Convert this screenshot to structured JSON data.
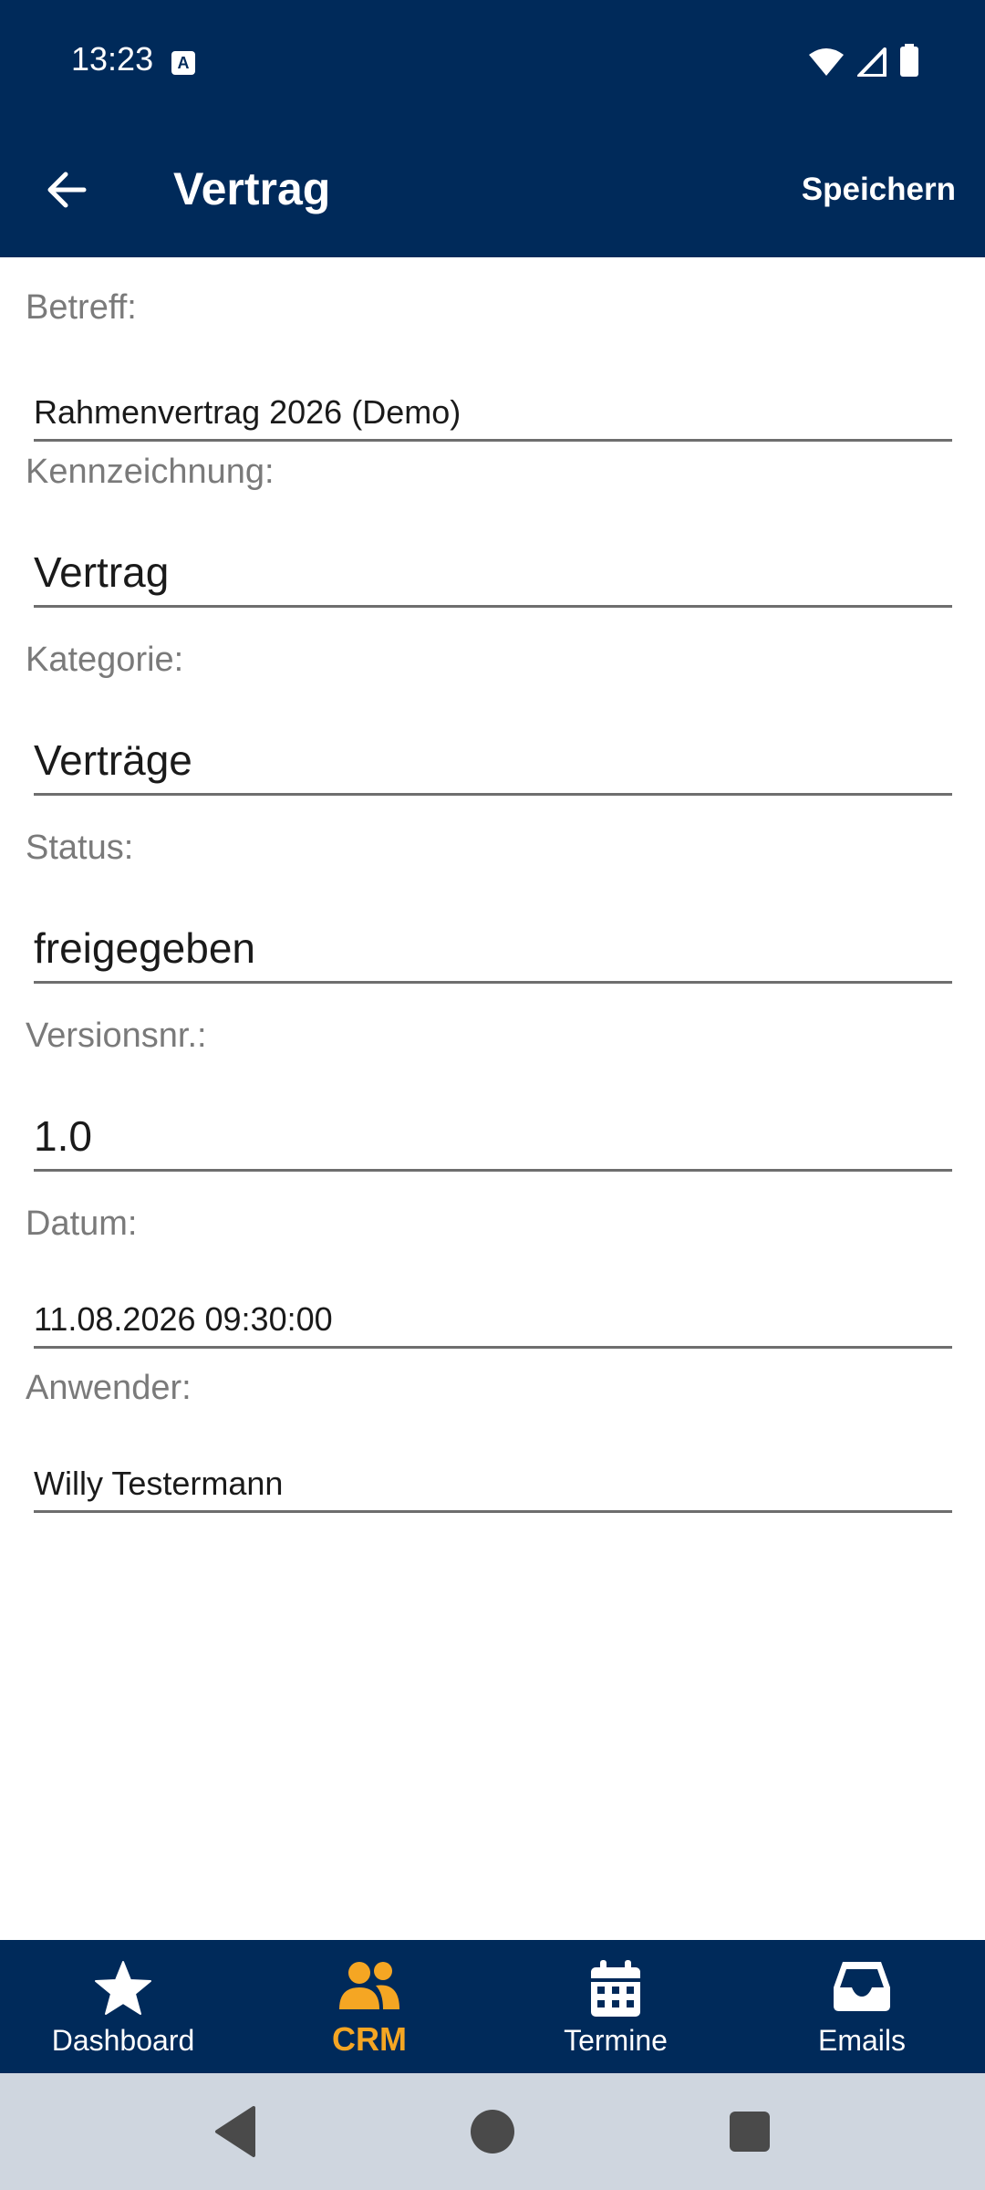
{
  "status_bar": {
    "time": "13:23",
    "notification_icon": "A",
    "icons": [
      "wifi-icon",
      "signal-icon",
      "battery-icon"
    ]
  },
  "app_bar": {
    "title": "Vertrag",
    "save_label": "Speichern",
    "back_icon": "arrow-left-icon"
  },
  "form": {
    "fields": [
      {
        "label": "Betreff:",
        "value": "Rahmenvertrag 2026 (Demo)"
      },
      {
        "label": "Kennzeichnung:",
        "value": "Vertrag"
      },
      {
        "label": "Kategorie:",
        "value": "Verträge"
      },
      {
        "label": "Status:",
        "value": "freigegeben"
      },
      {
        "label": "Versionsnr.:",
        "value": "1.0"
      },
      {
        "label": "Datum:",
        "value": "11.08.2026 09:30:00"
      },
      {
        "label": "Anwender:",
        "value": "Willy Testermann"
      }
    ]
  },
  "bottom_nav": {
    "items": [
      {
        "label": "Dashboard",
        "icon": "star-icon",
        "active": false
      },
      {
        "label": "CRM",
        "icon": "people-icon",
        "active": true
      },
      {
        "label": "Termine",
        "icon": "calendar-icon",
        "active": false
      },
      {
        "label": "Emails",
        "icon": "inbox-icon",
        "active": false
      }
    ]
  },
  "colors": {
    "primary": "#002a5a",
    "accent": "#f5a623",
    "label_gray": "#7a7a7a",
    "system_nav": "#cfd6df"
  }
}
